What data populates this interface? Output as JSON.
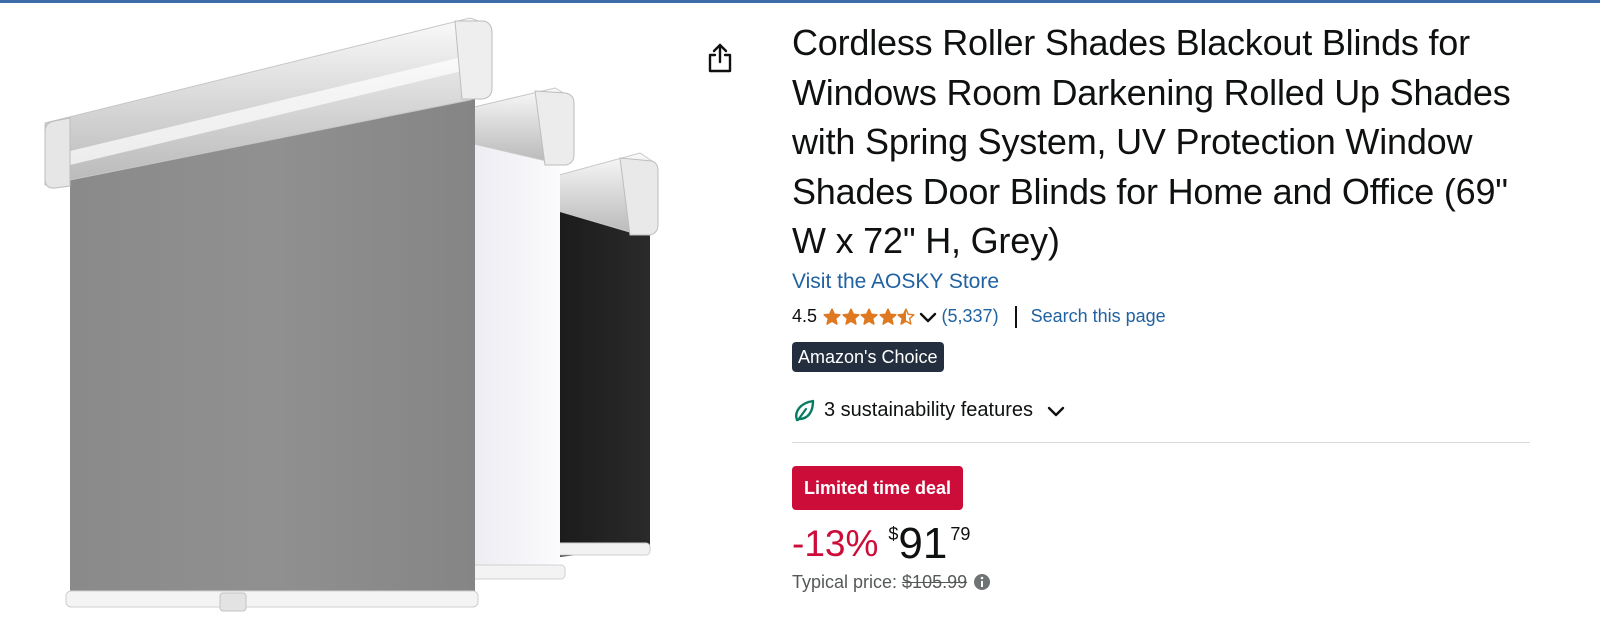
{
  "product": {
    "title": "Cordless Roller Shades Blackout Blinds for Windows Room Darkening Rolled Up Shades with Spring System, UV Protection Window Shades Door Blinds for Home and Office (69\" W x 72\" H, Grey)",
    "image_alt": "Grey, white and black roller shades"
  },
  "store": {
    "link_text": "Visit the AOSKY Store"
  },
  "rating": {
    "value": "4.5",
    "stars_filled": 4.5,
    "stars_total": 5,
    "review_count": "(5,337)",
    "search_link": "Search this page"
  },
  "badges": {
    "choice": "Amazon's Choice",
    "deal": "Limited time deal"
  },
  "sustainability": {
    "label": "3 sustainability features"
  },
  "price": {
    "discount": "-13%",
    "symbol": "$",
    "whole": "91",
    "fraction": "79",
    "typical_label": "Typical price:",
    "typical_value": "$105.99"
  },
  "colors": {
    "link": "#2162a1",
    "deal_red": "#cc0c39",
    "star_orange": "#de7921",
    "badge_dark": "#232f3e",
    "leaf_green": "#067d62"
  },
  "icons": {
    "share": "share-icon",
    "star": "star-icon",
    "chevron": "chevron-down-icon",
    "leaf": "leaf-icon",
    "info": "info-icon"
  }
}
